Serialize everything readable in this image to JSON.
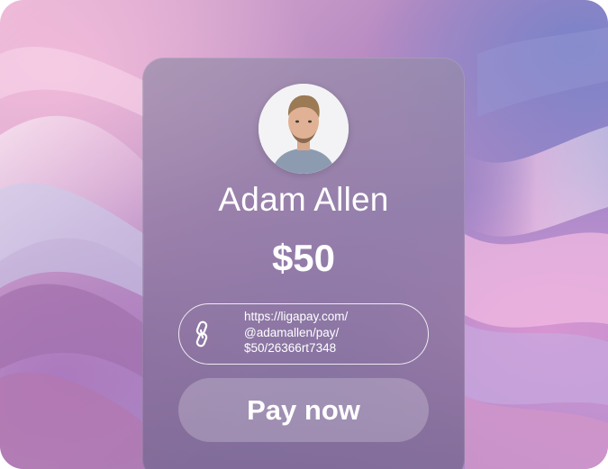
{
  "profile": {
    "name": "Adam Allen",
    "avatar_icon": "user-avatar"
  },
  "payment": {
    "amount": "$50",
    "link_lines": [
      "https://ligapay.com/",
      "@adamallen/pay/",
      "$50/26366rt7348"
    ],
    "link_icon": "link-icon",
    "pay_button_label": "Pay now"
  },
  "colors": {
    "text": "#ffffff",
    "accent_pink": "#e9b7d6",
    "accent_purple": "#9c86c7"
  }
}
